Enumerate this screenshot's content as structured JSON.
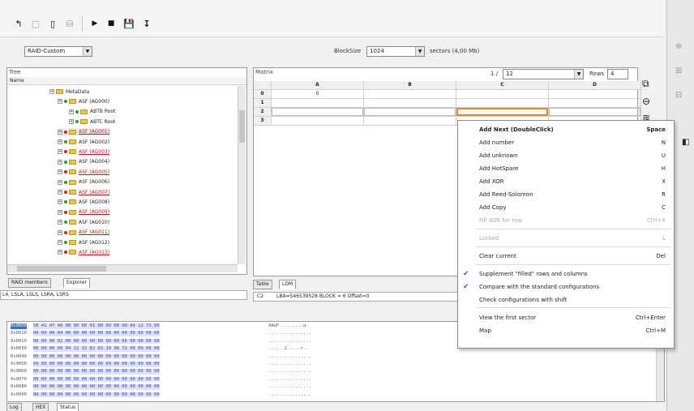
{
  "toolbar": {
    "icons": [
      "pointer-icon",
      "blank-icon",
      "document-icon",
      "disk-stack-icon",
      "play-icon",
      "stop-icon",
      "save-icon",
      "sort-icon"
    ]
  },
  "raid_combo": "RAID-Custom",
  "blocksize": {
    "label": "BlockSize",
    "value": "1024",
    "sectors": "sectors (4,00 Mb)"
  },
  "tree": {
    "title": "Tree",
    "column": "Name",
    "items": [
      {
        "label": "MetaData",
        "red": false,
        "level": 0
      },
      {
        "label": "ASF (AG000)",
        "red": false,
        "level": 1
      },
      {
        "label": "ABTB Root",
        "red": false,
        "level": 2
      },
      {
        "label": "ABTC Root",
        "red": false,
        "level": 2
      },
      {
        "label": "ASF (AG001)",
        "red": true,
        "level": 1
      },
      {
        "label": "ASF (AG002)",
        "red": false,
        "level": 1
      },
      {
        "label": "ASF (AG003)",
        "red": true,
        "level": 1
      },
      {
        "label": "ASF (AG004)",
        "red": false,
        "level": 1
      },
      {
        "label": "ASF (AG005)",
        "red": true,
        "level": 1
      },
      {
        "label": "ASF (AG006)",
        "red": false,
        "level": 1
      },
      {
        "label": "ASF (AG007)",
        "red": true,
        "level": 1
      },
      {
        "label": "ASF (AG008)",
        "red": false,
        "level": 1
      },
      {
        "label": "ASF (AG009)",
        "red": true,
        "level": 1
      },
      {
        "label": "ASF (AG010)",
        "red": false,
        "level": 1
      },
      {
        "label": "ASF (AG011)",
        "red": true,
        "level": 1
      },
      {
        "label": "ASF (AG012)",
        "red": false,
        "level": 1
      },
      {
        "label": "ASF (AG013)",
        "red": true,
        "level": 1
      }
    ]
  },
  "left_tabs": [
    "RAID members",
    "Explorer"
  ],
  "left_status": "L4, LSLA, LSLS, LSRA, LSRS",
  "matrix": {
    "title": "Matrix",
    "page": "1 /",
    "page_value": "12",
    "rows_label": "Rows",
    "rows_value": "4",
    "columns": [
      "A",
      "B",
      "C",
      "D"
    ],
    "row_numbers": [
      "0",
      "1",
      "2",
      "3"
    ],
    "cell_a0": "0"
  },
  "matrix_tabs": [
    "Table",
    "LDM"
  ],
  "matrix_status": {
    "cell": "C2",
    "info": "LBA=546539528 BLOCK = 6 Offset=0"
  },
  "context_menu": {
    "items": [
      {
        "label": "Add Next (DoubleClick)",
        "key": "Space",
        "bold": true,
        "disabled": false,
        "checked": false
      },
      {
        "label": "Add number",
        "key": "N",
        "bold": false,
        "disabled": false,
        "checked": false
      },
      {
        "label": "Add unknown",
        "key": "U",
        "bold": false,
        "disabled": false,
        "checked": false
      },
      {
        "label": "Add HotSpare",
        "key": "H",
        "bold": false,
        "disabled": false,
        "checked": false
      },
      {
        "label": "Add XOR",
        "key": "X",
        "bold": false,
        "disabled": false,
        "checked": false
      },
      {
        "label": "Add Reed-Solomon",
        "key": "R",
        "bold": false,
        "disabled": false,
        "checked": false
      },
      {
        "label": "Add Copy",
        "key": "C",
        "bold": false,
        "disabled": false,
        "checked": false
      },
      {
        "label": "Fill XOR for row",
        "key": "Ctrl+X",
        "bold": false,
        "disabled": true,
        "checked": false
      },
      {
        "label": "Locked",
        "key": "L",
        "bold": false,
        "disabled": true,
        "checked": false
      },
      {
        "label": "Clear current",
        "key": "Del",
        "bold": false,
        "disabled": false,
        "checked": false
      },
      {
        "label": "Supplement \"filled\" rows and columns",
        "key": "",
        "bold": false,
        "disabled": false,
        "checked": true
      },
      {
        "label": "Compare with the standard configurations",
        "key": "",
        "bold": false,
        "disabled": false,
        "checked": true
      },
      {
        "label": "Check configurations with shift",
        "key": "",
        "bold": false,
        "disabled": false,
        "checked": false
      },
      {
        "label": "View the first sector",
        "key": "Ctrl+Enter",
        "bold": false,
        "disabled": false,
        "checked": false
      },
      {
        "label": "Map",
        "key": "Ctrl+M",
        "bold": false,
        "disabled": false,
        "checked": false
      }
    ]
  },
  "hex": {
    "offsets": [
      "0x0000",
      "0x0010",
      "0x0020",
      "0x0030",
      "0x0040",
      "0x0050",
      "0x0060",
      "0x0070",
      "0x0080",
      "0x0090"
    ],
    "bytes": [
      "58 41 47 46 00 00 00 01 00 00 00 00 04 12 71 00",
      "00 00 00 04 00 00 00 00 00 00 00 00 00 00 00 00",
      "00 00 00 02 00 00 00 00 00 00 00 06 00 00 00 00",
      "00 00 00 06 04 12 32 82 03 10 98 72 00 00 00 00",
      "00 00 00 00 00 00 00 00 00 00 00 00 00 00 00 00",
      "00 00 00 00 00 00 00 00 00 00 00 00 00 00 00 00",
      "00 00 00 00 00 00 00 00 00 00 00 00 00 00 00 00",
      "00 00 00 00 00 00 00 00 00 00 00 00 00 00 00 00",
      "00 00 00 00 00 00 00 00 00 00 00 00 00 00 00 00",
      "00 00 00 00 00 00 00 00 00 00 00 00 00 00 00 00"
    ],
    "ascii": [
      "XAGF.........q.",
      "................",
      "................",
      "......2.....r..",
      "................",
      "................",
      "................",
      "................",
      "................",
      "................"
    ]
  },
  "bottom_tabs": [
    "Log",
    "HEX",
    "Status"
  ]
}
